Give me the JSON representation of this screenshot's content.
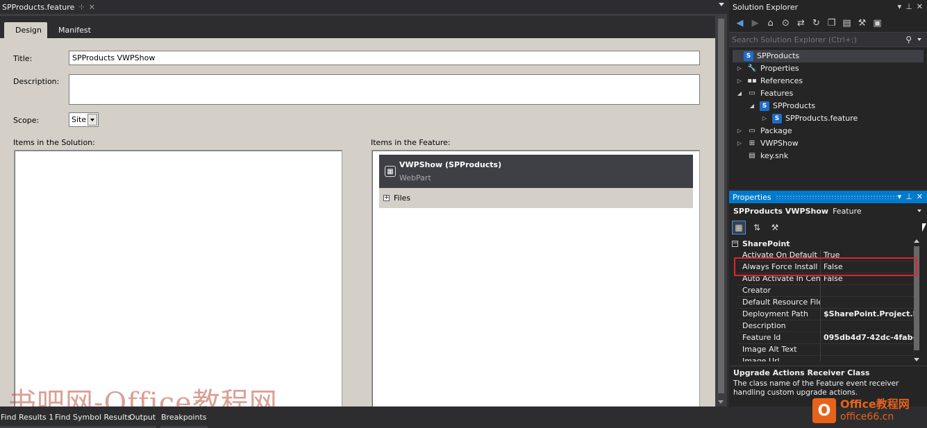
{
  "doc_tab": {
    "title": "SPProducts.feature",
    "pin": "⊹",
    "close": "✕"
  },
  "designer": {
    "tabs": [
      {
        "label": "Design"
      },
      {
        "label": "Manifest"
      }
    ],
    "title_label": "Title:",
    "title_value": "SPProducts VWPShow",
    "description_label": "Description:",
    "description_value": "",
    "scope_label": "Scope:",
    "scope_value": "Site",
    "items_in_solution_label": "Items in the Solution:",
    "items_in_feature_label": "Items in the Feature:",
    "feature_item": {
      "name": "VWPShow (SPProducts)",
      "type": "WebPart"
    },
    "files_label": "Files"
  },
  "bottom_tabs": [
    {
      "label": "Find Results 1"
    },
    {
      "label": "Find Symbol Results"
    },
    {
      "label": "Output"
    },
    {
      "label": "Breakpoints"
    }
  ],
  "solution_explorer": {
    "title": "Solution Explorer",
    "search_placeholder": "Search Solution Explorer (Ctrl+;)",
    "tree": [
      {
        "label": "SPProducts",
        "icon": "sharepoint-project-icon",
        "expanded": "open"
      },
      {
        "label": "Properties",
        "icon": "wrench-icon",
        "expanded": "closed"
      },
      {
        "label": "References",
        "icon": "references-icon",
        "expanded": "closed"
      },
      {
        "label": "Features",
        "icon": "folder-icon",
        "expanded": "open"
      },
      {
        "label": "SPProducts",
        "icon": "feature-icon",
        "expanded": "open"
      },
      {
        "label": "SPProducts.feature",
        "icon": "feature-file-icon",
        "expanded": "closed"
      },
      {
        "label": "Package",
        "icon": "package-icon",
        "expanded": "closed"
      },
      {
        "label": "VWPShow",
        "icon": "webpart-icon",
        "expanded": "closed"
      },
      {
        "label": "key.snk",
        "icon": "key-file-icon",
        "expanded": "none"
      }
    ]
  },
  "properties": {
    "title": "Properties",
    "object_name": "SPProducts VWPShow",
    "object_type": "Feature",
    "category": "SharePoint",
    "rows": [
      {
        "name": "Activate On Default",
        "value": "True",
        "bold": false
      },
      {
        "name": "Always Force Install",
        "value": "False",
        "bold": false
      },
      {
        "name": "Auto Activate In Central",
        "value": "False",
        "bold": false
      },
      {
        "name": "Creator",
        "value": "",
        "bold": false
      },
      {
        "name": "Default Resource File",
        "value": "",
        "bold": false
      },
      {
        "name": "Deployment Path",
        "value": "$SharePoint.Project.F",
        "bold": true
      },
      {
        "name": "Description",
        "value": "",
        "bold": false
      },
      {
        "name": "Feature Id",
        "value": "095db4d7-42dc-4fab-",
        "bold": true
      },
      {
        "name": "Image Alt Text",
        "value": "",
        "bold": false
      },
      {
        "name": "Image Url",
        "value": "",
        "bold": false
      }
    ],
    "description_title": "Upgrade Actions Receiver Class",
    "description_text": "The class name of the Feature event receiver handling custom upgrade actions."
  },
  "watermark_text": "书吧网-Office教程网",
  "logo": {
    "line1": "Office教程网",
    "line2": "office66.cn"
  },
  "colors": {
    "accent": "#007acc",
    "highlight": "#e0242d",
    "logo": "#e8631a"
  }
}
